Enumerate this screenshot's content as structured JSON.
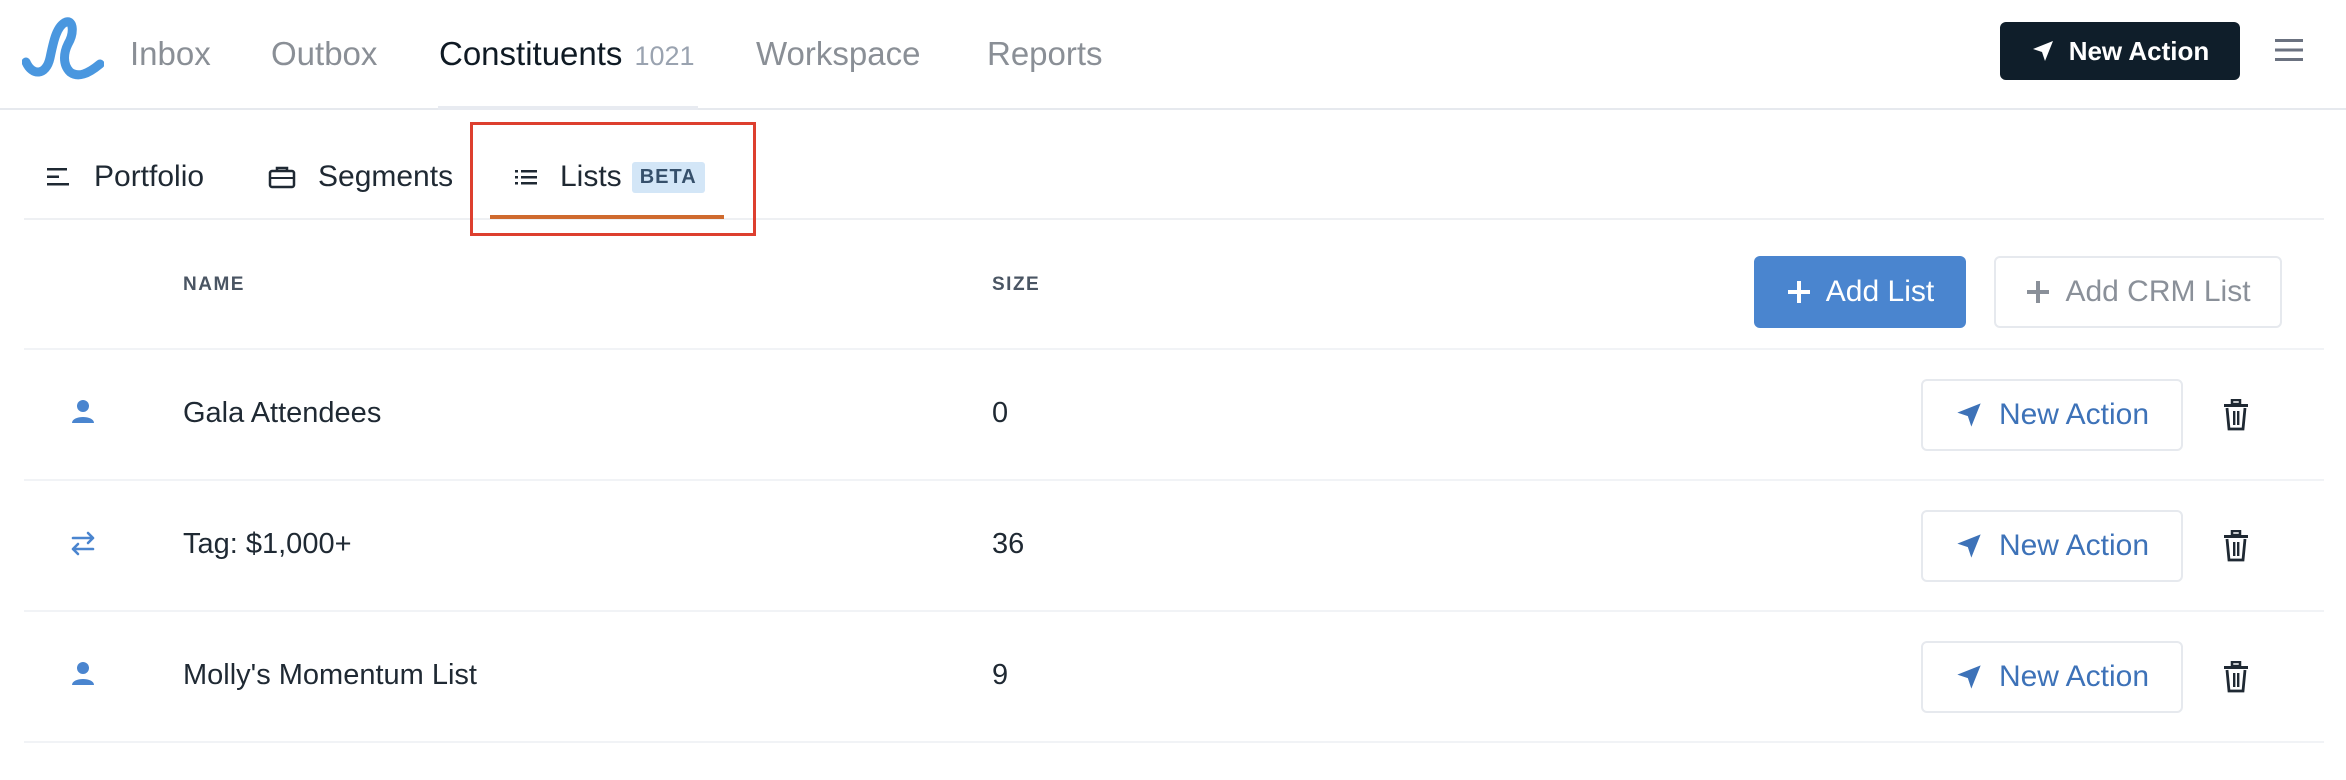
{
  "nav": {
    "items": [
      {
        "label": "Inbox"
      },
      {
        "label": "Outbox"
      },
      {
        "label": "Constituents",
        "count": "1021"
      },
      {
        "label": "Workspace"
      },
      {
        "label": "Reports"
      }
    ],
    "new_action_label": "New Action"
  },
  "subtabs": [
    {
      "label": "Portfolio",
      "icon": "align-left-icon"
    },
    {
      "label": "Segments",
      "icon": "briefcase-icon"
    },
    {
      "label": "Lists",
      "icon": "list-icon",
      "badge": "BETA"
    }
  ],
  "table": {
    "columns": [
      "NAME",
      "SIZE"
    ],
    "add_list_label": "Add List",
    "add_crm_list_label": "Add CRM List",
    "rows": [
      {
        "icon": "person-icon",
        "name": "Gala Attendees",
        "size": "0",
        "action_label": "New Action"
      },
      {
        "icon": "sync-arrows-icon",
        "name": "Tag: $1,000+",
        "size": "36",
        "action_label": "New Action"
      },
      {
        "icon": "person-icon",
        "name": "Molly's Momentum List",
        "size": "9",
        "action_label": "New Action"
      }
    ]
  },
  "colors": {
    "accent_blue": "#4a85cf",
    "dark_button": "#0f1e2a",
    "active_tab_underline": "#cf6a2e",
    "highlight_box": "#dd3f2f",
    "beta_badge_bg": "#d3e6f7",
    "link_blue": "#3d72b8"
  }
}
